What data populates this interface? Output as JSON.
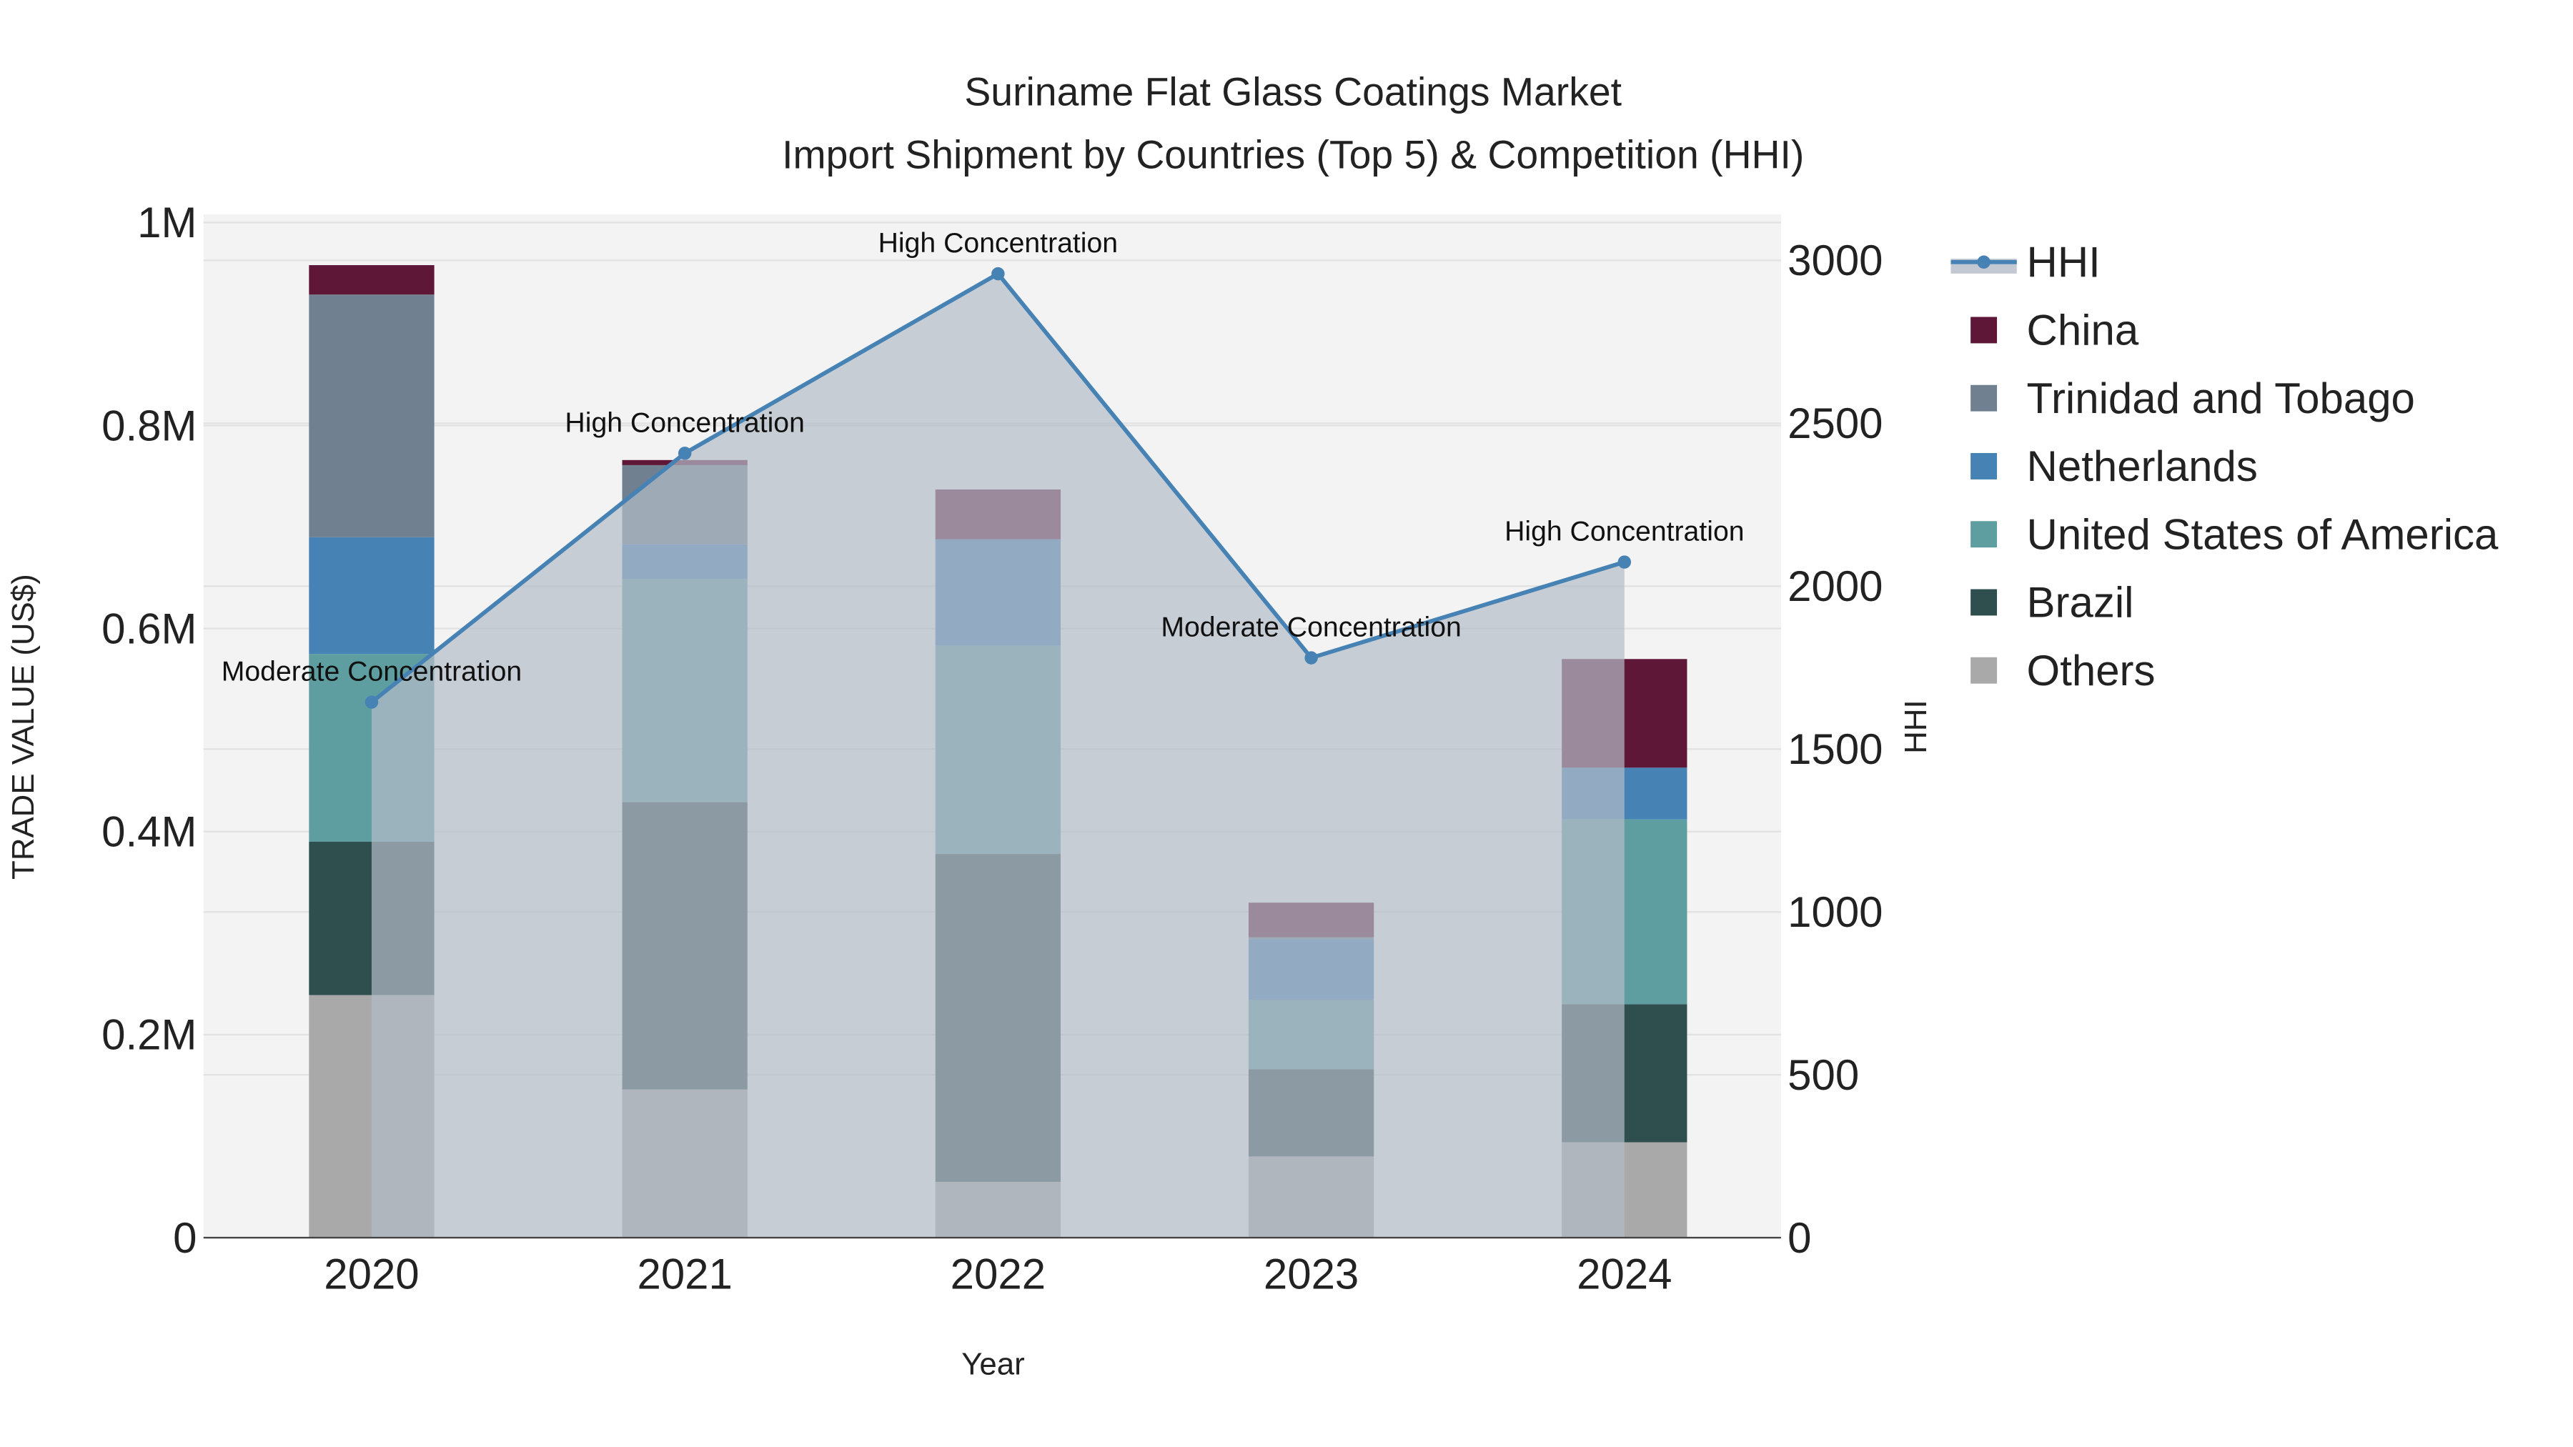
{
  "chart_data": {
    "type": "bar",
    "title": "Suriname Flat Glass Coatings Market",
    "subtitle": "Import Shipment by Countries (Top 5) & Competition (HHI)",
    "xlabel": "Year",
    "ylabel": "TRADE VALUE (US$)",
    "y2label": "HHI",
    "categories": [
      "2020",
      "2021",
      "2022",
      "2023",
      "2024"
    ],
    "ylim": [
      0,
      1000000
    ],
    "y2lim": [
      0,
      3130
    ],
    "yticks": [
      {
        "v": 0,
        "label": "0"
      },
      {
        "v": 200000,
        "label": "0.2M"
      },
      {
        "v": 400000,
        "label": "0.4M"
      },
      {
        "v": 600000,
        "label": "0.6M"
      },
      {
        "v": 800000,
        "label": "0.8M"
      },
      {
        "v": 1000000,
        "label": "1M"
      }
    ],
    "y2ticks": [
      {
        "v": 0,
        "label": "0"
      },
      {
        "v": 500,
        "label": "500"
      },
      {
        "v": 1000,
        "label": "1000"
      },
      {
        "v": 1500,
        "label": "1500"
      },
      {
        "v": 2000,
        "label": "2000"
      },
      {
        "v": 2500,
        "label": "2500"
      },
      {
        "v": 3000,
        "label": "3000"
      }
    ],
    "series": [
      {
        "name": "Others",
        "color": "#a9a9a9",
        "values": [
          239000,
          146000,
          55000,
          80000,
          94000
        ]
      },
      {
        "name": "Brazil",
        "color": "#2f4f4f",
        "values": [
          151000,
          283000,
          323000,
          86000,
          136000
        ]
      },
      {
        "name": "United States of America",
        "color": "#5f9ea0",
        "values": [
          185000,
          220000,
          205000,
          68000,
          182000
        ]
      },
      {
        "name": "Netherlands",
        "color": "#4682b4",
        "values": [
          115000,
          34000,
          105000,
          60000,
          51000
        ]
      },
      {
        "name": "Trinidad and Tobago",
        "color": "#708090",
        "values": [
          239000,
          78000,
          0,
          2000,
          0
        ]
      },
      {
        "name": "China",
        "color": "#5e1736",
        "values": [
          29000,
          5000,
          49000,
          34000,
          107000
        ]
      }
    ],
    "hhi": {
      "name": "HHI",
      "color": "#4682b4",
      "values": [
        1644,
        2408,
        2959,
        1780,
        2074
      ],
      "annotations": [
        "Moderate Concentration",
        "High Concentration",
        "High Concentration",
        "Moderate Concentration",
        "High Concentration"
      ]
    },
    "legend": {
      "placement": "right",
      "order": [
        "HHI",
        "China",
        "Trinidad and Tobago",
        "Netherlands",
        "United States of America",
        "Brazil",
        "Others"
      ]
    }
  }
}
